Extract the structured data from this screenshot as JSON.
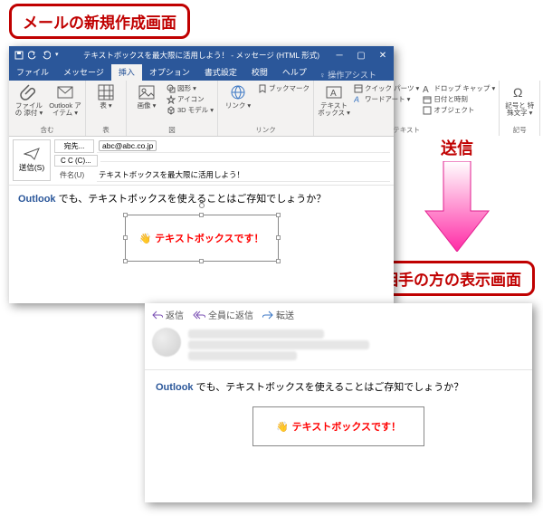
{
  "callout1": "メールの新規作成画面",
  "callout2": "相手の方の表示画面",
  "arrow_label": "送信",
  "titlebar": {
    "title": "テキストボックスを最大限に活用しよう！ - メッセージ (HTML 形式)"
  },
  "tabs": {
    "file": "ファイル",
    "message": "メッセージ",
    "insert": "挿入",
    "options": "オプション",
    "format": "書式設定",
    "review": "校閲",
    "help": "ヘルプ",
    "tellme": "操作アシスト"
  },
  "ribbon": {
    "attach_group_label": "含む",
    "attach_file": "ファイルの\n添付 ▾",
    "attach_outlook": "Outlook\nアイテム ▾",
    "table": "表\n▾",
    "tables_label": "表",
    "images": "画像\n▾",
    "shapes": "図形 ▾",
    "icons": "アイコン",
    "models": "3D モデル ▾",
    "illust_label": "図",
    "link": "リンク\n▾",
    "bookmark": "ブックマーク",
    "link_label": "リンク",
    "textbox": "テキスト\nボックス ▾",
    "quickparts": "クイック パーツ ▾",
    "wordart": "ワードアート ▾",
    "dropcap": "ドロップ キャップ ▾",
    "datetime": "日付と時刻",
    "object": "オブジェクト",
    "text_label": "テキスト",
    "symbols": "記号と\n特殊文字 ▾",
    "symbols_label": "記号"
  },
  "address": {
    "send": "送信(S)",
    "to_btn": "宛先...",
    "to_value": "abc@abc.co.jp",
    "cc_btn": "C C (C)...",
    "subject_label": "件名(U)",
    "subject_value": "テキストボックスを最大限に活用しよう！"
  },
  "body": {
    "line_blue": "Outlook",
    "line_rest": " でも、テキストボックスを使えることはご存知でしょうか？",
    "textbox_text": "テキストボックスです！"
  },
  "recv": {
    "reply": "返信",
    "reply_all": "全員に返信",
    "forward": "転送",
    "line_blue": "Outlook",
    "line_rest": " でも、テキストボックスを使えることはご存知でしょうか？",
    "textbox_text": "テキストボックスです！"
  }
}
